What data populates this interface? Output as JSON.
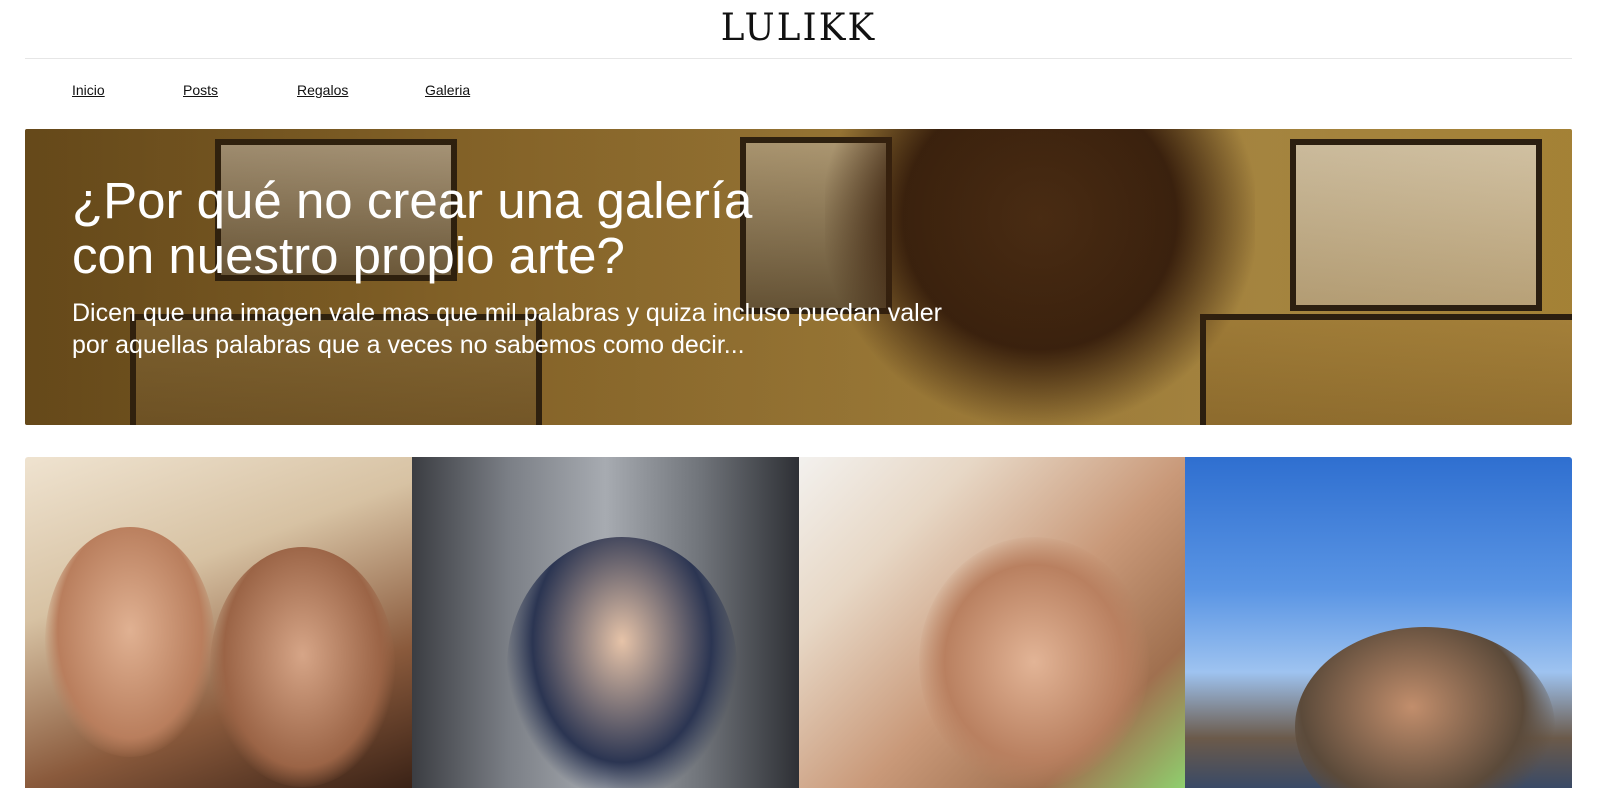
{
  "header": {
    "logo": "LULIKK"
  },
  "nav": {
    "items": [
      {
        "label": "Inicio"
      },
      {
        "label": "Posts"
      },
      {
        "label": "Regalos"
      },
      {
        "label": "Galeria"
      }
    ]
  },
  "hero": {
    "title": "¿Por qué no crear una galería con nuestro propio arte?",
    "subtitle": "Dicen que una imagen vale mas que mil palabras y quiza incluso puedan valer por aquellas palabras que a veces no sabemos como decir...",
    "background_tone": "#a07a34"
  },
  "gallery": {
    "photos": [
      {
        "icon": "photo-couple-selfie"
      },
      {
        "icon": "photo-elevator-mirror"
      },
      {
        "icon": "photo-portrait-lying"
      },
      {
        "icon": "photo-sky-couple"
      }
    ]
  }
}
